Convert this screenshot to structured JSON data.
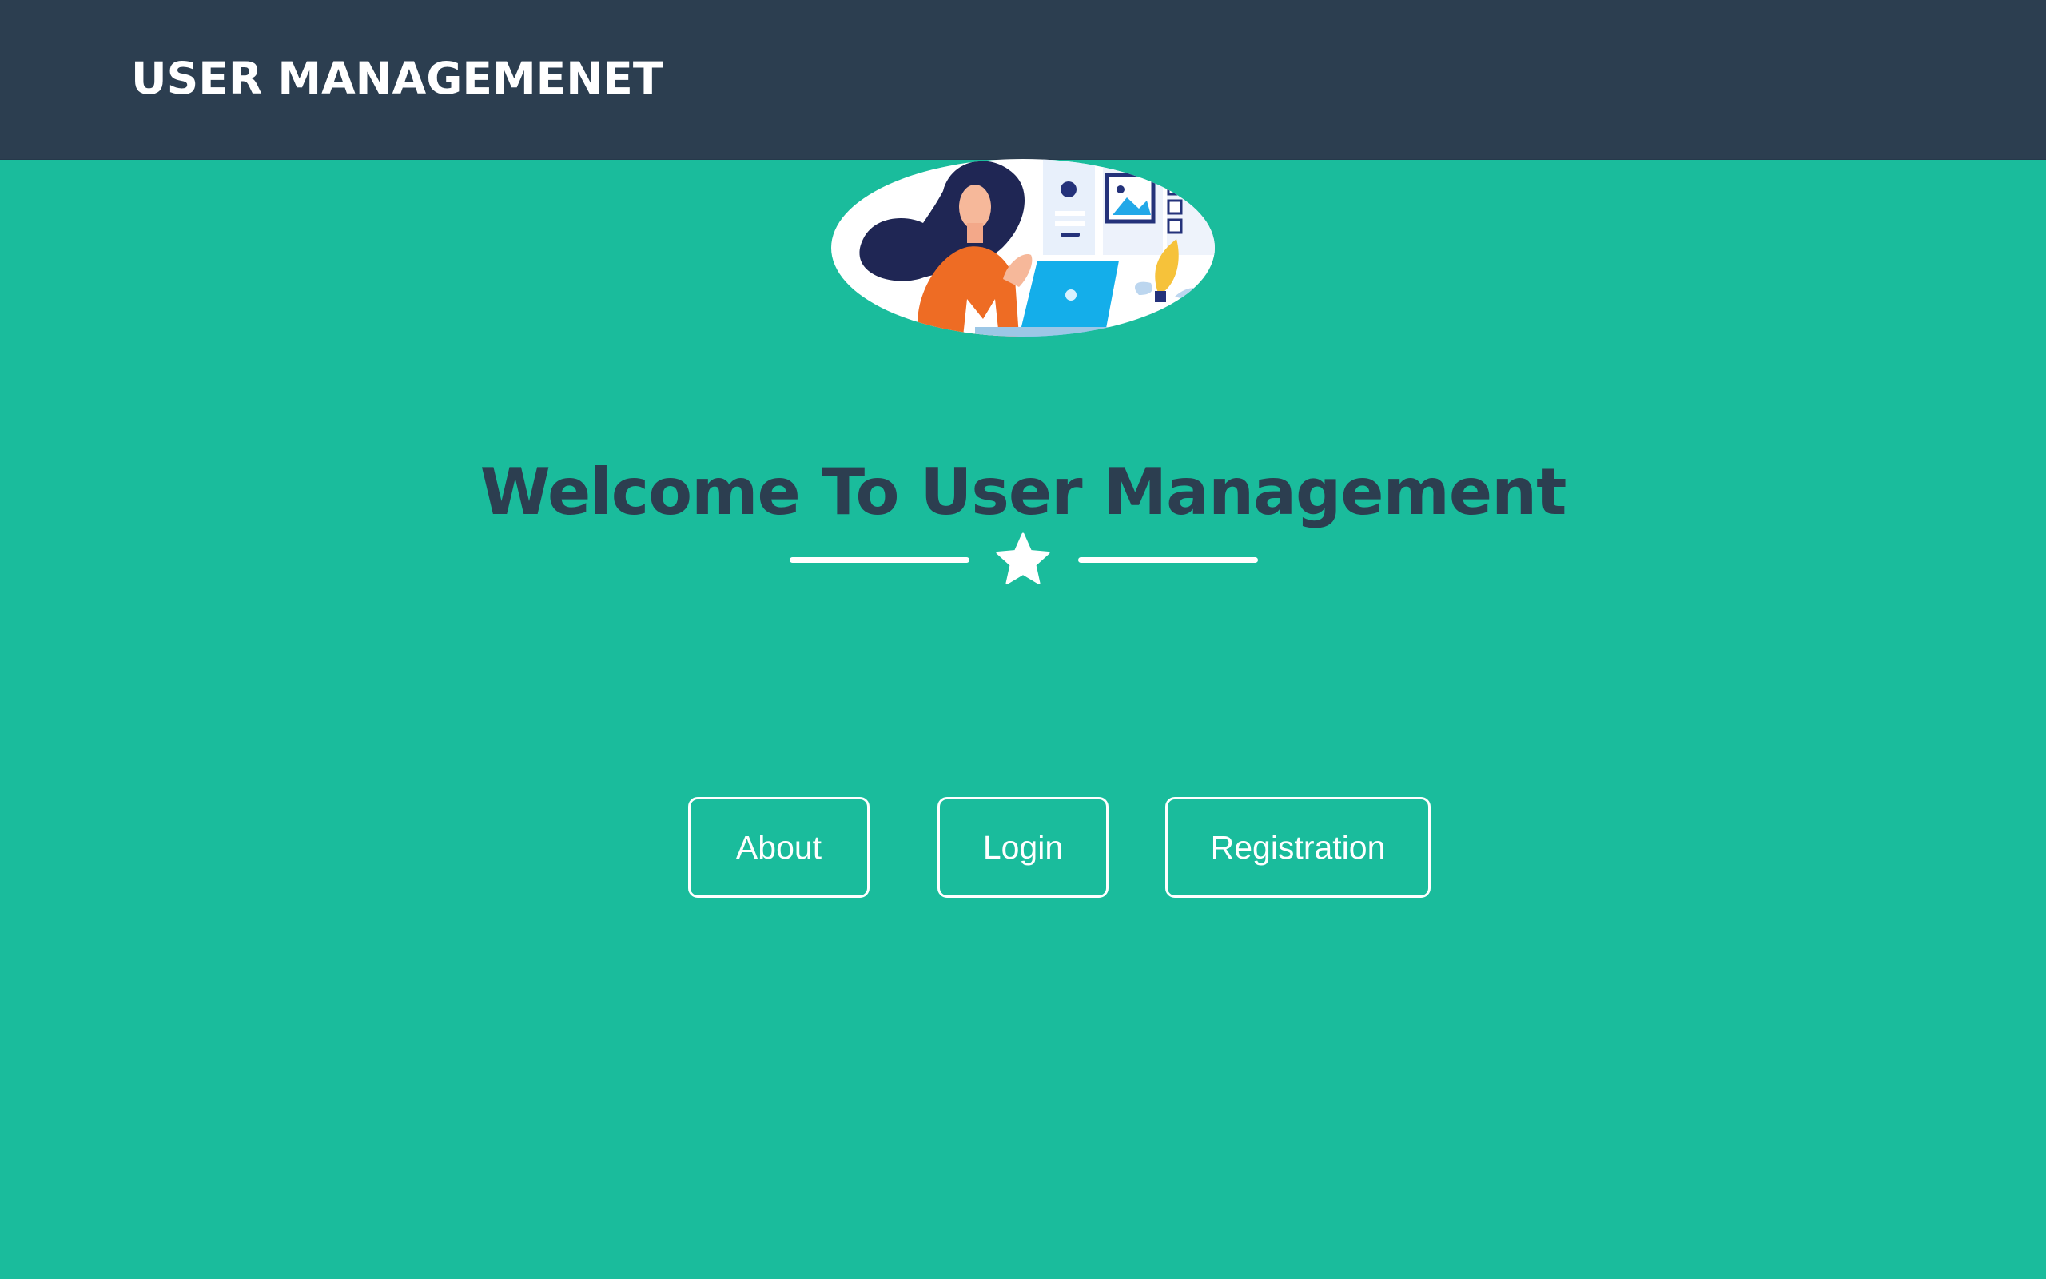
{
  "navbar": {
    "brand": "USER MANAGEMENET",
    "background": "#2c3e50"
  },
  "masthead": {
    "background": "#1abc9c",
    "heading": "Welcome To User Management",
    "heading_color": "#2c3e50",
    "avatar_description_icon": "woman-with-laptop-illustration",
    "divider_icon": "star-icon"
  },
  "buttons": {
    "about": "About",
    "login": "Login",
    "registration": "Registration"
  }
}
